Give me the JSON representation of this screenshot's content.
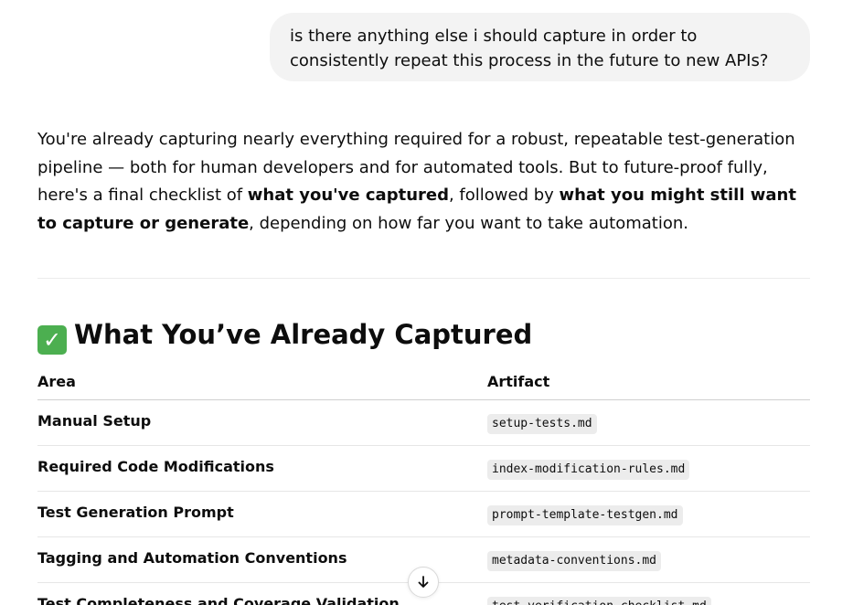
{
  "user_message": {
    "text": "is there anything else i should capture in order to consistently repeat this process in the future to new APIs?"
  },
  "assistant_message": {
    "intro_part1": "You're already capturing nearly everything required for a robust, repeatable test-generation pipeline — both for human developers and for automated tools. But to future-proof fully, here's a final checklist of ",
    "intro_bold1": "what you've captured",
    "intro_part2": ", followed by ",
    "intro_bold2": "what you might still want to capture or generate",
    "intro_part3": ", depending on how far you want to take automation."
  },
  "section": {
    "icon": "check-mark-button-icon",
    "icon_glyph": "✓",
    "icon_color": "#4caf50",
    "title": "What You’ve Already Captured"
  },
  "table": {
    "headers": {
      "area": "Area",
      "artifact": "Artifact"
    },
    "rows": [
      {
        "area": "Manual Setup",
        "artifact": "setup-tests.md"
      },
      {
        "area": "Required Code Modifications",
        "artifact": "index-modification-rules.md"
      },
      {
        "area": "Test Generation Prompt",
        "artifact": "prompt-template-testgen.md"
      },
      {
        "area": "Tagging and Automation Conventions",
        "artifact": "metadata-conventions.md"
      },
      {
        "area": "Test Completeness and Coverage Validation",
        "artifact": "test-verification-checklist.md"
      }
    ]
  },
  "scroll_button": {
    "icon": "arrow-down-icon"
  }
}
